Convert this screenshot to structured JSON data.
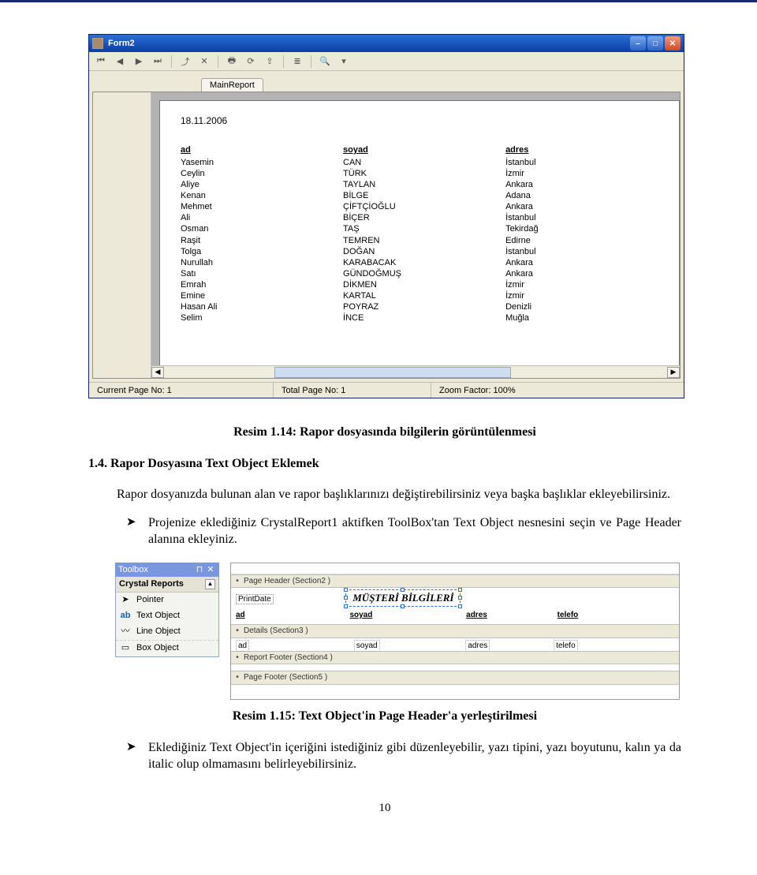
{
  "window": {
    "title": "Form2",
    "toolbar_icons": [
      "first",
      "prev",
      "next",
      "last",
      "goto",
      "close",
      "print",
      "refresh",
      "export",
      "tree",
      "find",
      "zoom"
    ],
    "tab_label": "MainReport",
    "status": {
      "current": "Current Page No: 1",
      "total": "Total Page No: 1",
      "zoom": "Zoom Factor: 100%"
    },
    "report": {
      "date": "18.11.2006",
      "headers": {
        "col1": "ad",
        "col2": "soyad",
        "col3": "adres"
      },
      "rows": [
        {
          "ad": "Yasemin",
          "soyad": "CAN",
          "adres": "İstanbul"
        },
        {
          "ad": "Ceylin",
          "soyad": "TÜRK",
          "adres": "İzmir"
        },
        {
          "ad": "Aliye",
          "soyad": "TAYLAN",
          "adres": "Ankara"
        },
        {
          "ad": "Kenan",
          "soyad": "BİLGE",
          "adres": "Adana"
        },
        {
          "ad": "Mehmet",
          "soyad": "ÇİFTÇİOĞLU",
          "adres": "Ankara"
        },
        {
          "ad": "Ali",
          "soyad": "BİÇER",
          "adres": "İstanbul"
        },
        {
          "ad": "Osman",
          "soyad": "TAŞ",
          "adres": "Tekirdağ"
        },
        {
          "ad": "Raşit",
          "soyad": "TEMREN",
          "adres": "Edirne"
        },
        {
          "ad": "Tolga",
          "soyad": "DOĞAN",
          "adres": "İstanbul"
        },
        {
          "ad": "Nurullah",
          "soyad": "KARABACAK",
          "adres": "Ankara"
        },
        {
          "ad": "Satı",
          "soyad": "GÜNDOĞMUŞ",
          "adres": "Ankara"
        },
        {
          "ad": "Emrah",
          "soyad": "DİKMEN",
          "adres": "İzmir"
        },
        {
          "ad": "Emine",
          "soyad": "KARTAL",
          "adres": "İzmir"
        },
        {
          "ad": "Hasan Ali",
          "soyad": "POYRAZ",
          "adres": "Denizli"
        },
        {
          "ad": "Selim",
          "soyad": "İNCE",
          "adres": "Muğla"
        }
      ]
    }
  },
  "caption1": "Resim 1.14: Rapor dosyasında bilgilerin görüntülenmesi",
  "heading": "1.4. Rapor Dosyasına Text Object Eklemek",
  "para1": "Rapor dosyanızda bulunan alan ve rapor başlıklarınızı değiştirebilirsiniz veya başka başlıklar ekleyebilirsiniz.",
  "bullet1": "Projenize eklediğiniz CrystalReport1 aktifken ToolBox'tan Text Object nesnesini seçin ve Page Header alanına ekleyiniz.",
  "toolbox": {
    "title": "Toolbox",
    "group": "Crystal Reports",
    "items": [
      "Pointer",
      "Text Object",
      "Line Object",
      "Box Object"
    ]
  },
  "designer": {
    "sec_ph": "Page Header (Section2 )",
    "sec_det": "Details (Section3 )",
    "sec_rf": "Report Footer (Section4 )",
    "sec_pf": "Page Footer (Section5 )",
    "printdate": "PrintDate",
    "textobj": "MÜŞTERİ BİLGİLERİ",
    "f_ad": "ad",
    "f_soyad": "soyad",
    "f_adres": "adres",
    "f_tel": "telefo"
  },
  "caption2": "Resim 1.15: Text Object'in Page Header'a yerleştirilmesi",
  "bullet2": "Eklediğiniz Text Object'in içeriğini istediğiniz gibi düzenleyebilir, yazı tipini, yazı boyutunu, kalın ya da italic olup olmamasını belirleyebilirsiniz.",
  "pageno": "10"
}
